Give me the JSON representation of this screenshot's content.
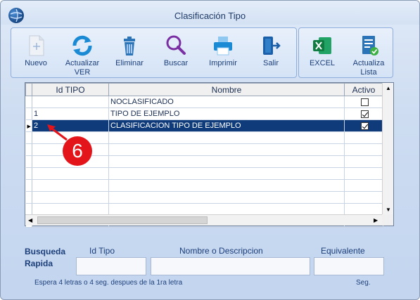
{
  "window": {
    "title": "Clasificación Tipo"
  },
  "toolbar": {
    "buttons": [
      {
        "label": "Nuevo"
      },
      {
        "label": "Actualizar\nVER"
      },
      {
        "label": "Eliminar"
      },
      {
        "label": "Buscar"
      },
      {
        "label": "Imprimir"
      },
      {
        "label": "Salir"
      }
    ],
    "right_buttons": [
      {
        "label": "EXCEL"
      },
      {
        "label": "Actualiza\nLista"
      }
    ]
  },
  "grid": {
    "columns": [
      "Id TIPO",
      "Nombre",
      "Activo"
    ],
    "rows": [
      {
        "id": "",
        "nombre": "NOCLASIFICADO",
        "activo": false,
        "current": false
      },
      {
        "id": "1",
        "nombre": "TIPO DE EJEMPLO",
        "activo": true,
        "current": false
      },
      {
        "id": "2",
        "nombre": "CLASIFICACION TIPO DE EJEMPLO",
        "activo": true,
        "current": true
      }
    ],
    "empty_rows": 8
  },
  "search": {
    "label_line1": "Busqueda",
    "label_line2": "Rapida",
    "id_label": "Id Tipo",
    "name_label": "Nombre o Descripcion",
    "equiv_label": "Equivalente",
    "id_value": "",
    "name_value": "",
    "equiv_value": "",
    "hint": "Espera 4 letras o 4 seg. despues de la 1ra letra",
    "seg": "Seg."
  },
  "annotation": {
    "badge": "6",
    "color": "#e4141b"
  }
}
